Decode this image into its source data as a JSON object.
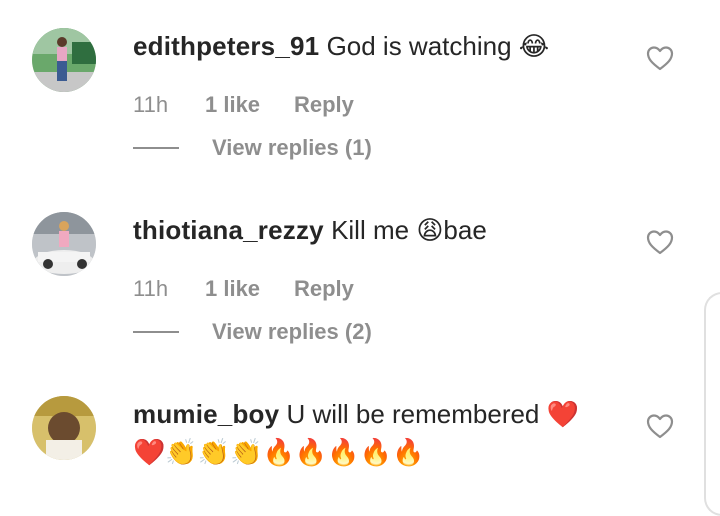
{
  "comments": [
    {
      "username": "edithpeters_91",
      "text": "God is watching",
      "emoji": "😂",
      "time": "11h",
      "likes": "1 like",
      "reply": "Reply",
      "view_replies": "View replies (1)"
    },
    {
      "username": "thiotiana_rezzy",
      "text": "Kill me",
      "emoji": "😩",
      "text_after": "bae",
      "time": "11h",
      "likes": "1 like",
      "reply": "Reply",
      "view_replies": "View replies (2)"
    },
    {
      "username": "mumie_boy",
      "text": "U will be remembered",
      "emoji": "❤️",
      "emoji_line": "❤️👏👏👏🔥🔥🔥🔥🔥"
    }
  ],
  "icons": {
    "like": "heart-outline-icon"
  },
  "colors": {
    "text": "#262626",
    "muted": "#8e8e8e",
    "background": "#ffffff"
  }
}
